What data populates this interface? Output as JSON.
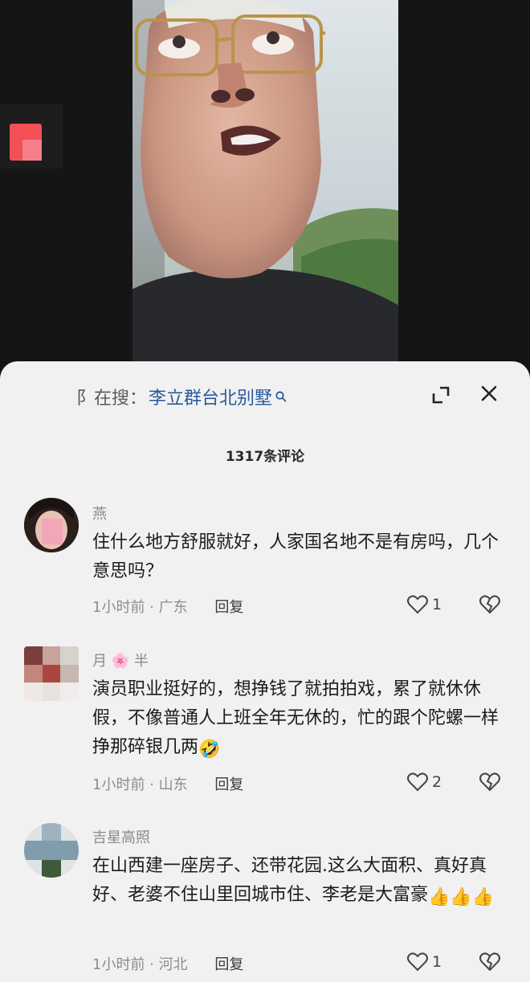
{
  "video": {
    "thumb_icon": "red-square-icon",
    "frame_subject": "man-with-glasses-video-frame"
  },
  "search": {
    "prefix": "阝在搜：",
    "query": "李立群台北别墅",
    "icon": "search-icon"
  },
  "header": {
    "expand_icon": "expand-corner-icon",
    "close_icon": "close-icon",
    "comment_count": "1317条评论"
  },
  "comments": [
    {
      "username": "燕",
      "text": "住什么地方舒服就好，人家国名地不是有房吗，几个意思吗？",
      "meta": "1小时前 · 广东",
      "reply_label": "回复",
      "likes": "1"
    },
    {
      "username": "月 🌸 半",
      "text": "演员职业挺好的，想挣钱了就拍拍戏，累了就休休假，不像普通人上班全年无休的，忙的跟个陀螺一样挣那碎银几两",
      "emoji": "🤣",
      "meta": "1小时前 · 山东",
      "reply_label": "回复",
      "likes": "2"
    },
    {
      "username": "吉星高照",
      "text": "在山西建一座房子、还带花园.这么大面积、真好真好、老婆不住山里回城市住、李老是大富豪",
      "emoji": "👍👍👍",
      "meta": "1小时前 · 河北",
      "reply_label": "回复",
      "likes": "1"
    }
  ],
  "colors": {
    "sheet_bg": "#f1f1f1",
    "link_blue": "#2b5a9c",
    "text_dark": "#1c1c1c",
    "text_gray": "#8a8a8a",
    "thumb_red": "#f25056"
  }
}
